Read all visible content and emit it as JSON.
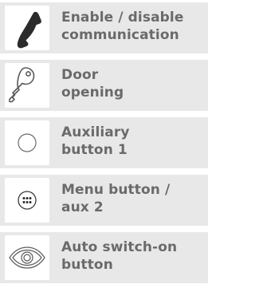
{
  "rows": [
    {
      "line1": "Enable / disable",
      "line2": "communication",
      "icon": "handset-icon"
    },
    {
      "line1": "Door",
      "line2": "opening",
      "icon": "key-icon"
    },
    {
      "line1": "Auxiliary",
      "line2": "button 1",
      "icon": "circle-icon"
    },
    {
      "line1": "Menu button /",
      "line2": "aux 2",
      "icon": "menu-dots-icon"
    },
    {
      "line1": "Auto switch-on",
      "line2": "button",
      "icon": "eye-icon"
    }
  ],
  "colors": {
    "row_background": "#e8e8e8",
    "icon_background": "#ffffff",
    "text": "#6a6a6a",
    "icon_stroke": "#5a5a5a"
  }
}
